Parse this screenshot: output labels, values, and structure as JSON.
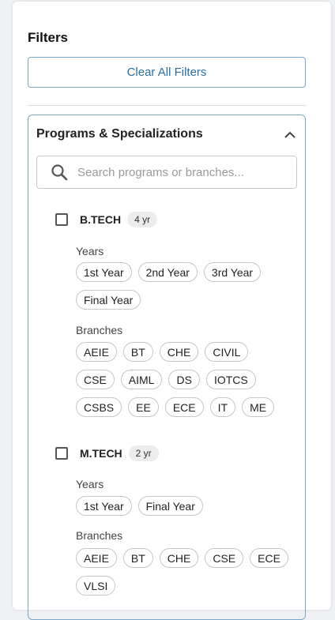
{
  "filters_title": "Filters",
  "clear_all_label": "Clear All Filters",
  "group": {
    "title": "Programs & Specializations",
    "expanded": true,
    "search_placeholder": "Search programs or branches..."
  },
  "programs": [
    {
      "name": "B.TECH",
      "duration": "4 yr",
      "checked": false,
      "years_label": "Years",
      "years": [
        "1st Year",
        "2nd Year",
        "3rd Year",
        "Final Year"
      ],
      "branches_label": "Branches",
      "branches": [
        "AEIE",
        "BT",
        "CHE",
        "CIVIL",
        "CSE",
        "AIML",
        "DS",
        "IOTCS",
        "CSBS",
        "EE",
        "ECE",
        "IT",
        "ME"
      ]
    },
    {
      "name": "M.TECH",
      "duration": "2 yr",
      "checked": false,
      "years_label": "Years",
      "years": [
        "1st Year",
        "Final Year"
      ],
      "branches_label": "Branches",
      "branches": [
        "AEIE",
        "BT",
        "CHE",
        "CSE",
        "ECE",
        "VLSI"
      ]
    }
  ],
  "colors": {
    "accent_border": "#7aa7c9",
    "accent_text": "#2b6ea3",
    "chip_border": "#c7c7c7"
  }
}
